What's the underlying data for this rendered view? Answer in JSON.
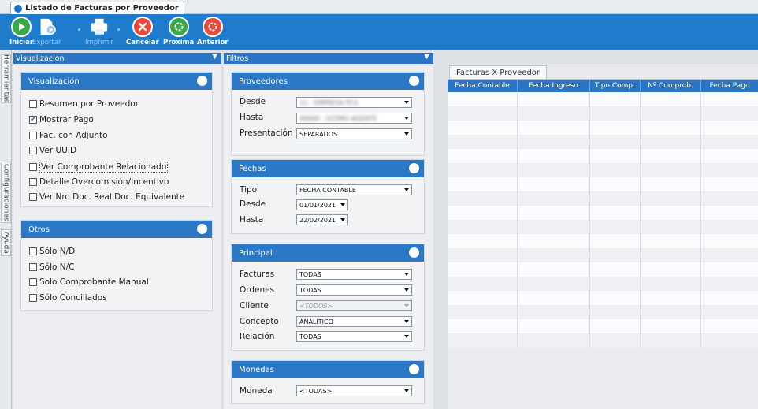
{
  "window": {
    "tab_title": "Listado de Facturas por Proveedor"
  },
  "toolbar": {
    "buttons": [
      {
        "label": "Iniciar",
        "icon": "play-icon",
        "enabled": true
      },
      {
        "label": "Exportar",
        "icon": "export-icon",
        "enabled": false
      },
      {
        "label": "Imprimir",
        "icon": "printer-icon",
        "enabled": false
      },
      {
        "label": "Cancelar",
        "icon": "cancel-icon",
        "enabled": true
      },
      {
        "label": "Proxima",
        "icon": "next-icon",
        "enabled": true
      },
      {
        "label": "Anterior",
        "icon": "previous-icon",
        "enabled": true
      }
    ]
  },
  "side_tabs": [
    "Herramientas",
    "Configuraciones",
    "Ayuda"
  ],
  "visualizacion_panel": {
    "title": "Visualizacion",
    "groups": {
      "visualizacion": {
        "title": "Visualización",
        "items": [
          {
            "label": "Resumen por Proveedor",
            "checked": false
          },
          {
            "label": "Mostrar Pago",
            "checked": true
          },
          {
            "label": "Fac. con Adjunto",
            "checked": false
          },
          {
            "label": "Ver UUID",
            "checked": false
          },
          {
            "label": "Ver Comprobante Relacionado",
            "checked": false,
            "focused": true
          },
          {
            "label": "Detalle Overcomisión/Incentivo",
            "checked": false
          },
          {
            "label": "Ver Nro Doc. Real Doc. Equivalente",
            "checked": false
          }
        ]
      },
      "otros": {
        "title": "Otros",
        "items": [
          {
            "label": "Sólo N/D",
            "checked": false
          },
          {
            "label": "Sólo N/C",
            "checked": false
          },
          {
            "label": "Solo Comprobante Manual",
            "checked": false
          },
          {
            "label": "Sólo Conciliados",
            "checked": false
          }
        ]
      }
    }
  },
  "filtros_panel": {
    "title": "Filtros",
    "proveedores": {
      "title": "Proveedores",
      "desde_label": "Desde",
      "desde_value": "11 - EMPRESA PCS",
      "hasta_label": "Hasta",
      "hasta_value": "99999 - ULTIMO AGENTE",
      "presentacion_label": "Presentación",
      "presentacion_value": "SEPARADOS"
    },
    "fechas": {
      "title": "Fechas",
      "tipo_label": "Tipo",
      "tipo_value": "FECHA CONTABLE",
      "desde_label": "Desde",
      "desde_value": "01/01/2021",
      "hasta_label": "Hasta",
      "hasta_value": "22/02/2021"
    },
    "principal": {
      "title": "Principal",
      "facturas_label": "Facturas",
      "facturas_value": "TODAS",
      "ordenes_label": "Ordenes",
      "ordenes_value": "TODAS",
      "cliente_label": "Cliente",
      "cliente_value": "<TODOS>",
      "concepto_label": "Concepto",
      "concepto_value": "ANALITICO",
      "relacion_label": "Relación",
      "relacion_value": "TODAS"
    },
    "monedas": {
      "title": "Monedas",
      "moneda_label": "Moneda",
      "moneda_value": "<TODAS>"
    }
  },
  "grid": {
    "tab_title": "Facturas X Proveedor",
    "columns": [
      "Fecha Contable",
      "Fecha Ingreso",
      "Tipo Comp.",
      "Nº Comprob.",
      "Fecha Pago"
    ]
  },
  "colors": {
    "ribbon": "#1f7ccd",
    "group_header": "#2b78c6",
    "grid_header": "#2a76c4"
  }
}
